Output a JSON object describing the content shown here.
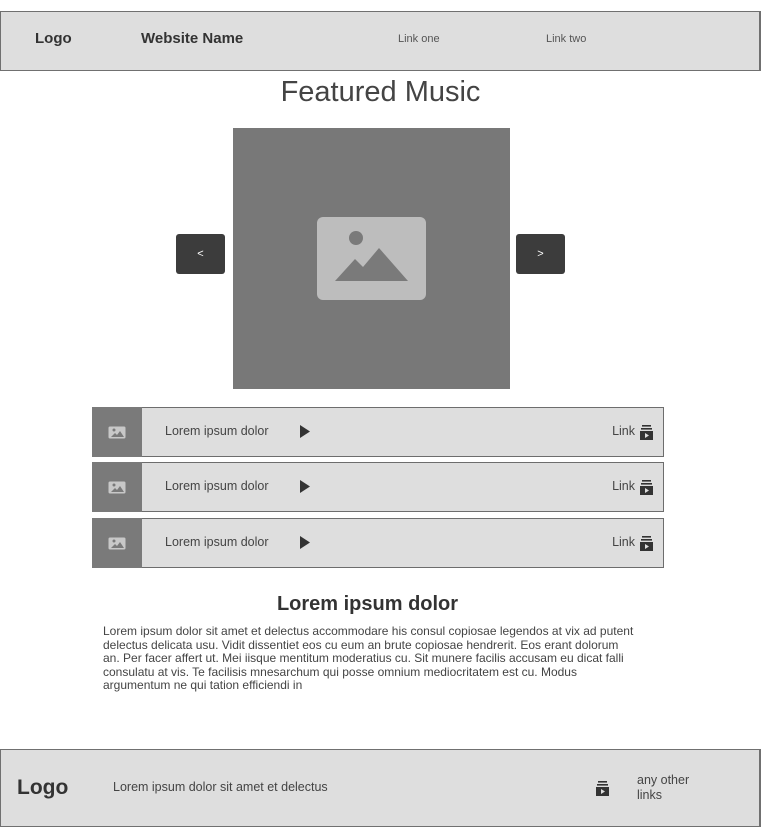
{
  "header": {
    "logo": "Logo",
    "site_name": "Website Name",
    "nav": [
      "Link one",
      "Link two"
    ]
  },
  "main": {
    "title": "Featured Music",
    "carousel": {
      "prev_label": "<",
      "next_label": ">",
      "image_icon": "image-placeholder-icon"
    },
    "tracks": [
      {
        "title": "Lorem ipsum dolor",
        "link": "Link"
      },
      {
        "title": "Lorem ipsum dolor",
        "link": "Link"
      },
      {
        "title": "Lorem ipsum dolor",
        "link": "Link"
      }
    ],
    "section": {
      "heading": "Lorem ipsum dolor",
      "body": "Lorem ipsum dolor sit amet et delectus accommodare his consul copiosae legendos at vix ad putent delectus delicata usu. Vidit dissentiet eos cu eum an brute copiosae hendrerit. Eos erant dolorum an. Per facer affert ut. Mei iisque mentitum moderatius cu. Sit munere facilis accusam eu dicat falli consulatu at vis. Te facilisis mnesarchum qui posse omnium mediocritatem est cu. Modus argumentum ne qui tation efficiendi in"
    }
  },
  "footer": {
    "logo": "Logo",
    "tagline": "Lorem ipsum dolor sit amet et delectus",
    "other_links": "any other links"
  },
  "colors": {
    "panel": "#dedede",
    "image": "#787878",
    "button": "#3c3c3c"
  }
}
